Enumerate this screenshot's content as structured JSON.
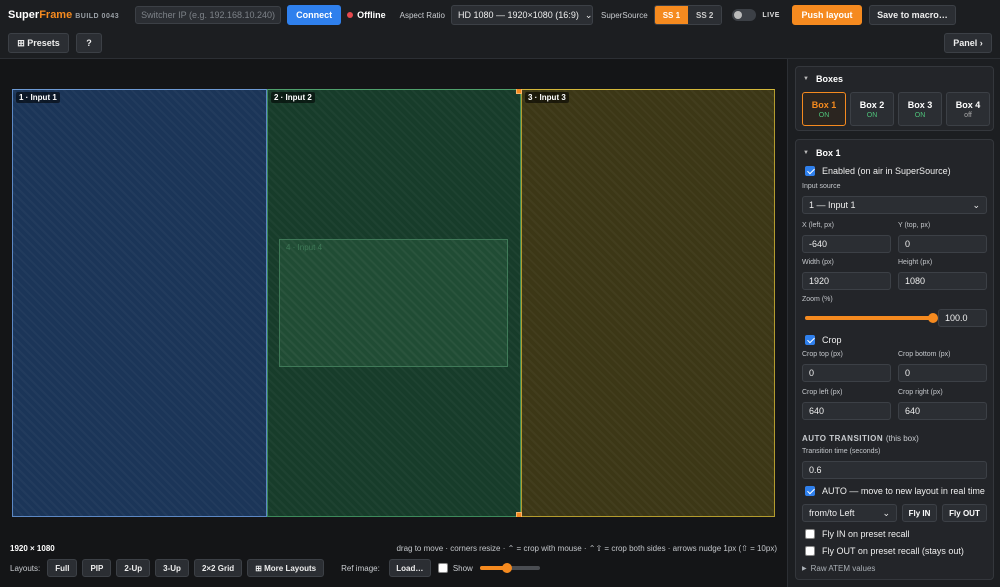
{
  "header": {
    "brand_a": "Super",
    "brand_b": "Frame",
    "build": "BUILD 0043",
    "ip_placeholder": "Switcher IP (e.g. 192.168.10.240)",
    "connect": "Connect",
    "status": "Offline",
    "aspect_label": "Aspect Ratio",
    "aspect_value": "HD 1080 — 1920×1080 (16:9)",
    "supersource_label": "SuperSource",
    "ss1": "SS 1",
    "ss2": "SS 2",
    "live": "LIVE",
    "push": "Push layout",
    "save": "Save to macro…"
  },
  "toolbar": {
    "presets": "⊞ Presets",
    "help": "?",
    "panel": "Panel ›"
  },
  "canvas": {
    "boxes": [
      {
        "label": "1 · Input 1"
      },
      {
        "label": "2 · Input 2"
      },
      {
        "label": "3 · Input 3"
      },
      {
        "label": "4 · Input 4"
      }
    ],
    "dims": "1920 × 1080",
    "hint": "drag to move · corners resize · ⌃ = crop with mouse · ⌃⇧ = crop both sides · arrows nudge 1px (⇧ = 10px)",
    "layouts_label": "Layouts:",
    "layouts": [
      "Full",
      "PIP",
      "2-Up",
      "3-Up",
      "2×2 Grid",
      "⊞ More Layouts"
    ],
    "ref_label": "Ref image:",
    "load": "Load…",
    "show": "Show",
    "ref_opacity": 0.45
  },
  "panel": {
    "boxes_title": "Boxes",
    "boxes": [
      {
        "name": "Box 1",
        "state": "ON"
      },
      {
        "name": "Box 2",
        "state": "ON"
      },
      {
        "name": "Box 3",
        "state": "ON"
      },
      {
        "name": "Box 4",
        "state": "off"
      }
    ],
    "box_title": "Box 1",
    "enabled": "Enabled (on air in SuperSource)",
    "input_source_label": "Input source",
    "input_source": "1 — Input 1",
    "x_label": "X (left, px)",
    "x": "-640",
    "y_label": "Y (top, px)",
    "y": "0",
    "w_label": "Width (px)",
    "w": "1920",
    "h_label": "Height (px)",
    "h": "1080",
    "zoom_label": "Zoom (%)",
    "zoom": "100.0",
    "zoom_fraction": 1.0,
    "crop": "Crop",
    "crop_top_label": "Crop top (px)",
    "crop_top": "0",
    "crop_bottom_label": "Crop bottom (px)",
    "crop_bottom": "0",
    "crop_left_label": "Crop left (px)",
    "crop_left": "640",
    "crop_right_label": "Crop right (px)",
    "crop_right": "640",
    "auto_title": "AUTO TRANSITION",
    "auto_sub": "(this box)",
    "trans_label": "Transition time (seconds)",
    "trans": "0.6",
    "auto_move": "AUTO — move to new layout in real time",
    "direction": "from/to Left",
    "fly_in": "Fly IN",
    "fly_out": "Fly OUT",
    "fly_in_recall": "Fly IN on preset recall",
    "fly_out_recall": "Fly OUT on preset recall (stays out)",
    "raw": "Raw ATEM values"
  }
}
